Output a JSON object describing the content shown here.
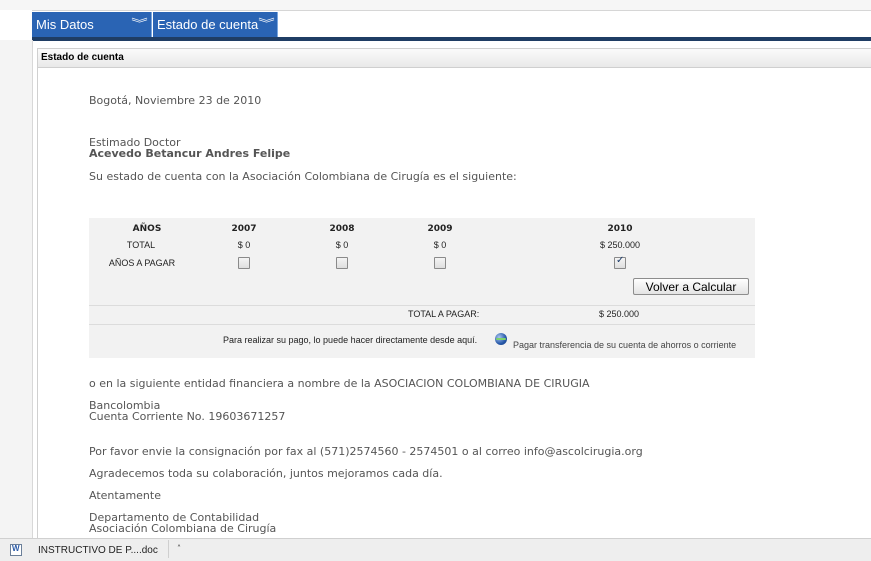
{
  "menu": {
    "items": [
      {
        "label": "Mis Datos"
      },
      {
        "label": "Estado de cuenta"
      }
    ],
    "chevron": "double-chevron-down-icon"
  },
  "panel": {
    "title": "Estado de cuenta"
  },
  "letter": {
    "date": "Bogotá, Noviembre 23 de 2010",
    "salutation": "Estimado Doctor",
    "name": "Acevedo Betancur Andres Felipe",
    "intro": "Su estado de cuenta con la Asociación Colombiana de Cirugía es el siguiente:"
  },
  "table": {
    "headers": [
      "AÑOS",
      "2007",
      "2008",
      "2009",
      "2010"
    ],
    "total_label": "TOTAL",
    "totals": [
      "$ 0",
      "$ 0",
      "$ 0",
      "$ 250.000"
    ],
    "pay_label": "AÑOS A PAGAR",
    "pay_checked": [
      false,
      false,
      false,
      true
    ],
    "recalc_button": "Volver a Calcular",
    "total_a_pagar_label": "TOTAL A PAGAR:",
    "total_a_pagar_value": "$ 250.000",
    "payment_note": "Para realizar su pago, lo puede hacer directamente desde aquí.",
    "transfer_link": "Pagar transferencia de su cuenta de ahorros o corriente"
  },
  "bank": {
    "text": "o en la siguiente entidad financiera a nombre de la ASOCIACION COLOMBIANA DE CIRUGIA",
    "name": "Bancolombia",
    "account": "Cuenta Corriente No. 19603671257"
  },
  "closing": {
    "fax": "Por favor envie la consignación por fax al (571)2574560 - 2574501 o al correo info@ascolcirugia.org",
    "thanks": "Agradecemos toda su colaboración, juntos mejoramos cada día.",
    "regards": "Atentamente",
    "dept": "Departamento de Contabilidad",
    "org": "Asociación Colombiana de Cirugía"
  },
  "taskbar": {
    "item": "INSTRUCTIVO DE P....doc",
    "arrow": "˄"
  }
}
